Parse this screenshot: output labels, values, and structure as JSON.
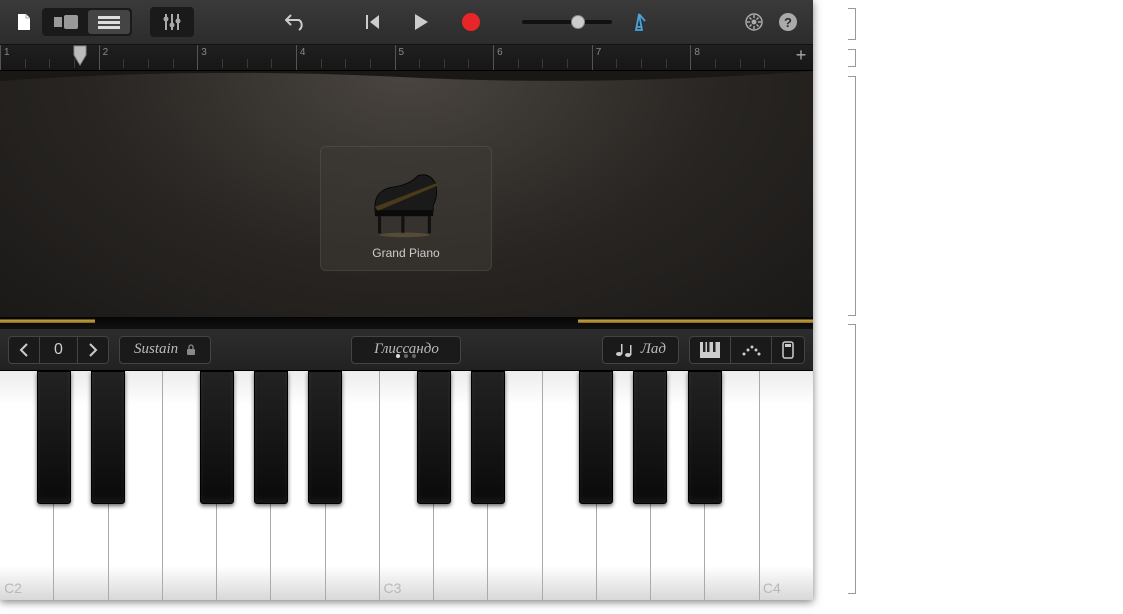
{
  "toolbar": {
    "icons": {
      "my_songs": "my-songs-icon",
      "browser": "browser-icon",
      "tracks": "tracks-icon",
      "controls": "track-controls-icon",
      "undo": "undo-icon",
      "go_to_start": "go-to-beginning-icon",
      "play": "play-icon",
      "record": "record-icon",
      "metronome": "metronome-icon",
      "settings": "settings-icon",
      "help": "help-icon"
    }
  },
  "ruler": {
    "bars": [
      1,
      2,
      3,
      4,
      5,
      6,
      7,
      8
    ],
    "add_label": "+"
  },
  "instrument": {
    "name": "Grand Piano"
  },
  "controls": {
    "octave_down": "<",
    "octave_value": "0",
    "octave_up": ">",
    "sustain_label": "Sustain",
    "glissando_label": "Глиссандо",
    "scale_prefix_icon": "note",
    "scale_label": "Лад"
  },
  "keyboard": {
    "white_count": 15,
    "labels": [
      {
        "pos": 0,
        "text": "C2"
      },
      {
        "pos": 7,
        "text": "C3"
      },
      {
        "pos": 14,
        "text": "C4"
      }
    ],
    "black_positions": [
      0,
      1,
      3,
      4,
      5,
      7,
      8,
      10,
      11,
      12
    ]
  }
}
